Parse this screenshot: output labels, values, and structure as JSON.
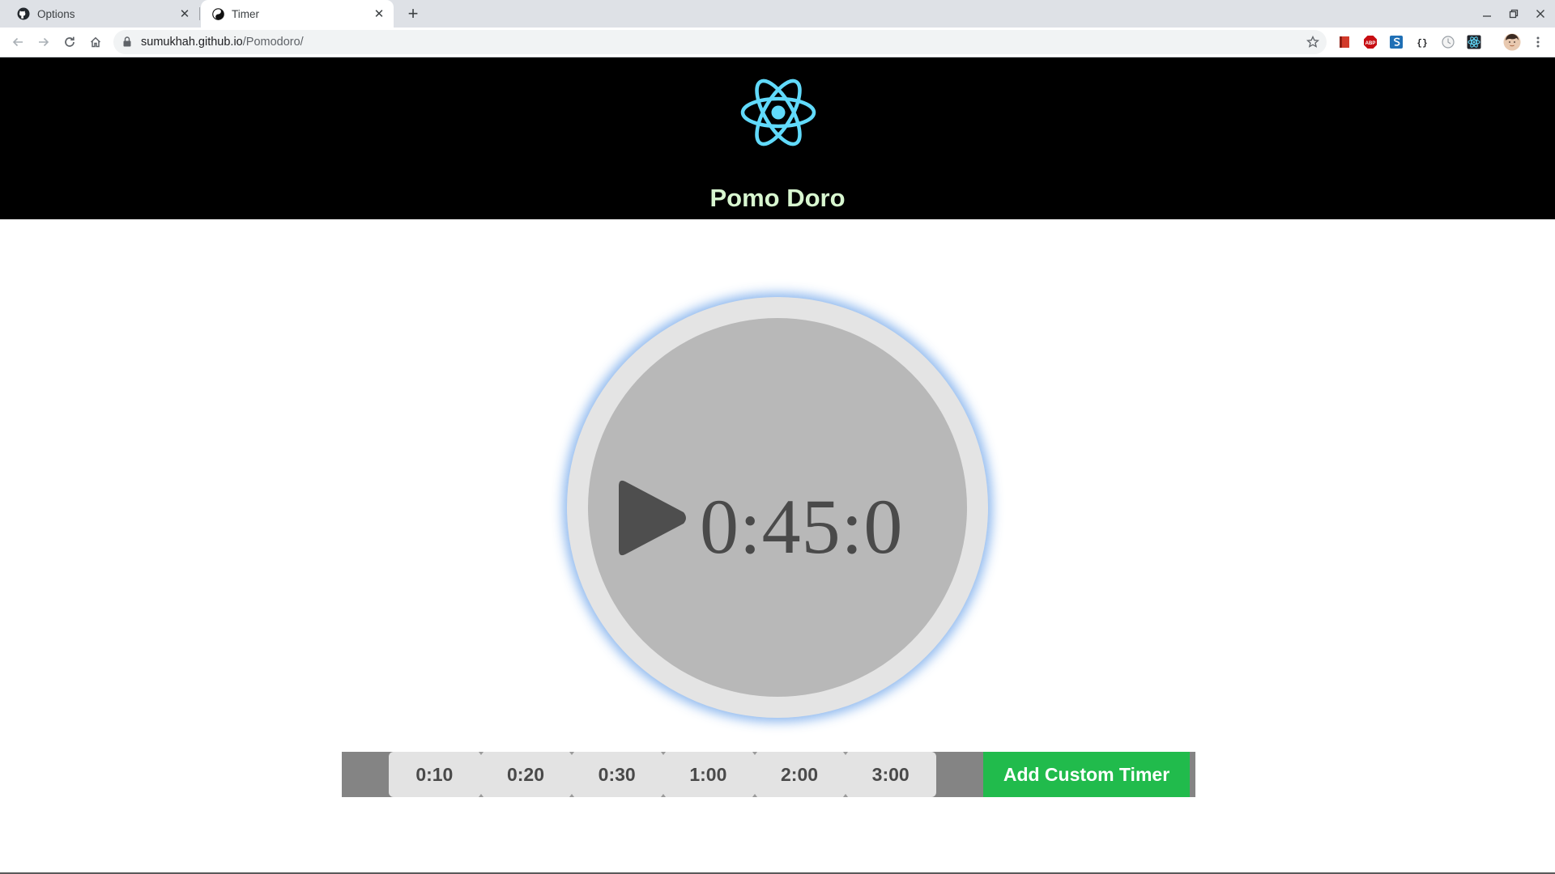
{
  "browser": {
    "tabs": [
      {
        "title": "Options",
        "icon": "github-icon",
        "active": false
      },
      {
        "title": "Timer",
        "icon": "yin-yang-icon",
        "active": true
      }
    ],
    "url_host": "sumukhah.github.io",
    "url_path": "/Pomodoro/",
    "extensions": [
      "red-bookmark-icon",
      "adblock-icon",
      "s-extension-icon",
      "json-viewer-icon",
      "timer-extension-icon",
      "react-devtools-icon"
    ]
  },
  "app": {
    "title": "Pomo Doro",
    "logo": "react-atom-icon",
    "logo_color": "#61dafb"
  },
  "timer": {
    "display": "0:45:0",
    "play_icon": "play-icon"
  },
  "presets": [
    "0:10",
    "0:20",
    "0:30",
    "1:00",
    "2:00",
    "3:00"
  ],
  "custom_button_label": "Add Custom Timer",
  "colors": {
    "header_bg": "#000000",
    "title_color": "#d8f7d0",
    "dial_ring": "#e4e4e4",
    "dial_face": "#b8b8b8",
    "glow": "#78aaeb",
    "custom_button": "#21bb4c",
    "preset_bg": "#e3e3e3",
    "bar_bg": "#848484"
  }
}
